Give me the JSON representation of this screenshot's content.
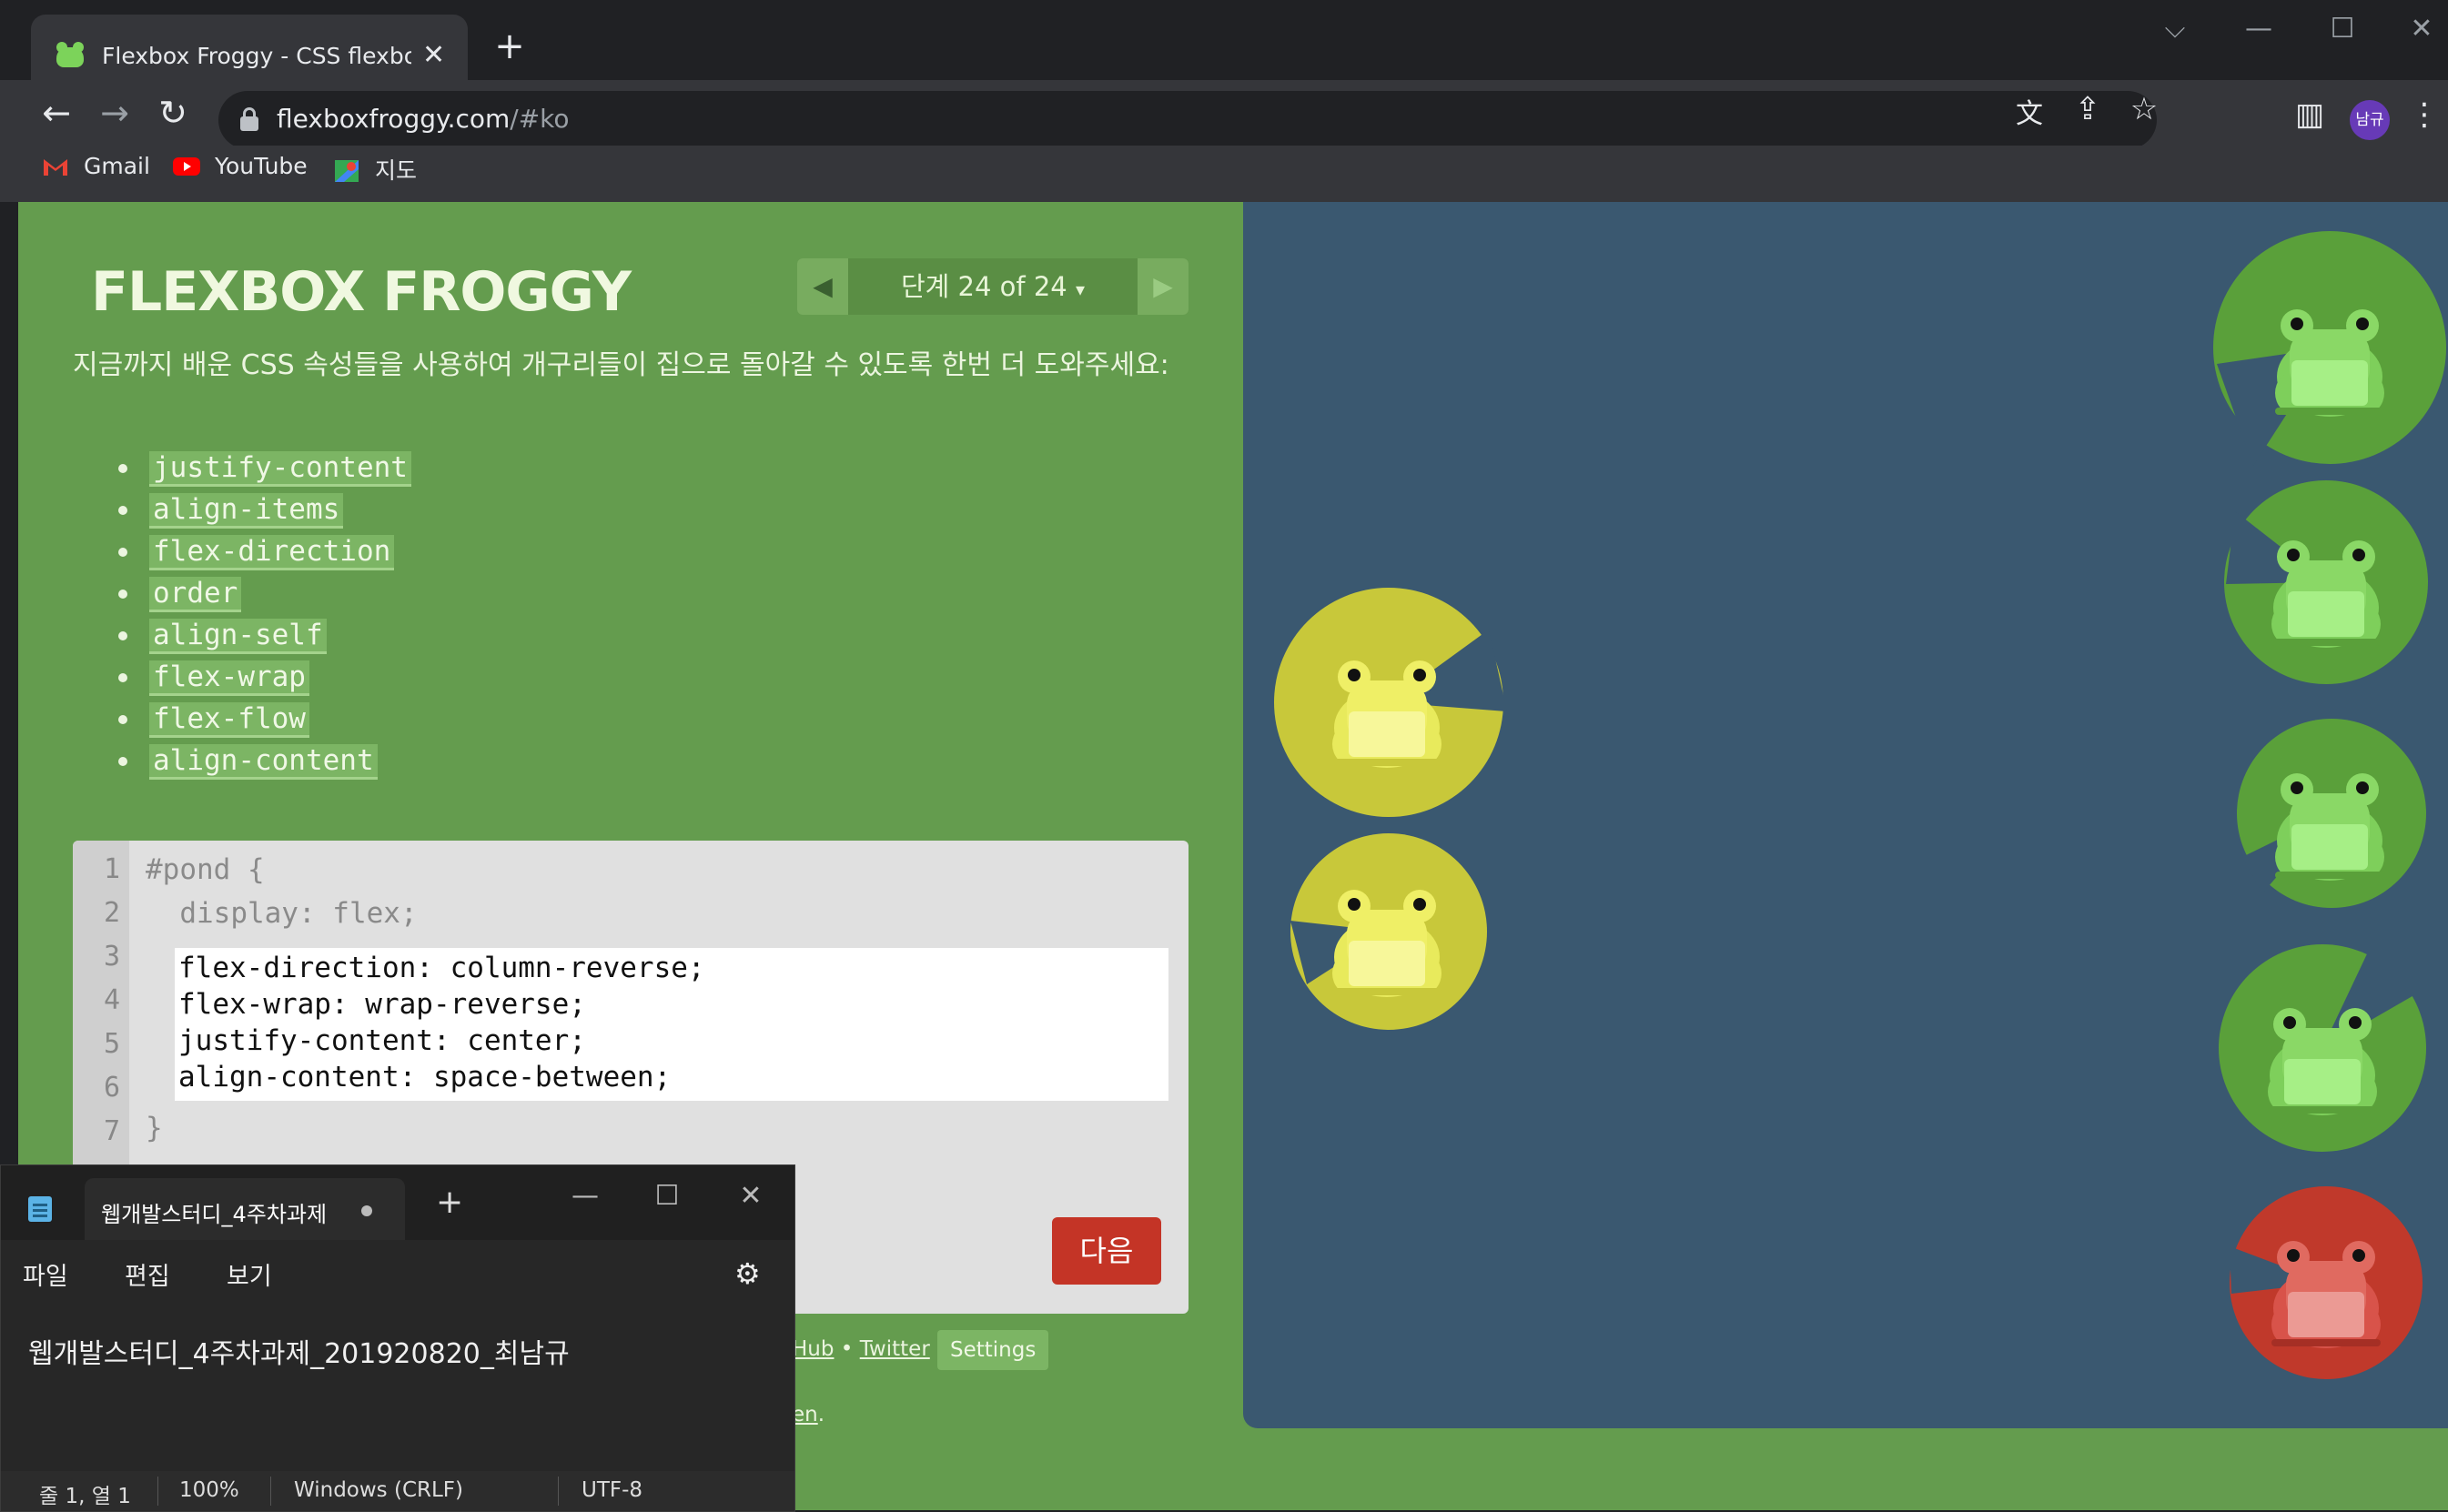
{
  "browser": {
    "tab_title": "Flexbox Froggy - CSS flexbox 속",
    "url_host": "flexboxfroggy.com",
    "url_path": "/#ko",
    "profile_initials": "남규",
    "bookmarks": [
      {
        "label": "Gmail"
      },
      {
        "label": "YouTube"
      },
      {
        "label": "지도"
      }
    ]
  },
  "game": {
    "logo": "FLEXBOX FROGGY",
    "level_label": "단계 24 of 24",
    "level_caret": "▾",
    "instructions": "지금까지 배운 CSS 속성들을 사용하여 개구리들이 집으로 돌아갈 수 있도록 한번 더 도와주세요:",
    "properties": [
      "justify-content",
      "align-items",
      "flex-direction",
      "order",
      "align-self",
      "flex-wrap",
      "flex-flow",
      "align-content"
    ],
    "editor": {
      "line_numbers": [
        "1",
        "2",
        "3",
        "4",
        "5",
        "6",
        "7"
      ],
      "line1": "#pond {",
      "line2": "  display: flex;",
      "input_lines": [
        "flex-direction: column-reverse;",
        "flex-wrap: wrap-reverse;",
        "justify-content: center;",
        "align-content: space-between;"
      ],
      "closing": "}"
    },
    "next_button": "다음",
    "footer": {
      "hub_fragment": "Hub",
      "bullet": "•",
      "twitter": "Twitter",
      "settings": "Settings",
      "en_fragment": "en",
      "period": "."
    }
  },
  "notepad": {
    "tab_title": "웹개발스터디_4주차과제",
    "menu": [
      "파일",
      "편집",
      "보기"
    ],
    "content": "웹개발스터디_4주차과제_201920820_최남규",
    "status": {
      "position": "줄 1, 열 1",
      "zoom": "100%",
      "line_ending": "Windows (CRLF)",
      "encoding": "UTF-8"
    }
  },
  "colors": {
    "page_green": "#649c4e",
    "pond": "#3a5870",
    "green_pad": "#5aa03a",
    "yellow_pad": "#c8c83a",
    "red_pad": "#c0392b",
    "next_button": "#c43426"
  },
  "icons": [
    "back-icon",
    "forward-icon",
    "reload-icon",
    "lock-icon",
    "translate-icon",
    "share-icon",
    "star-icon",
    "side-panel-icon",
    "menu-dots-icon",
    "settings-gear-icon",
    "notepad-app-icon"
  ]
}
